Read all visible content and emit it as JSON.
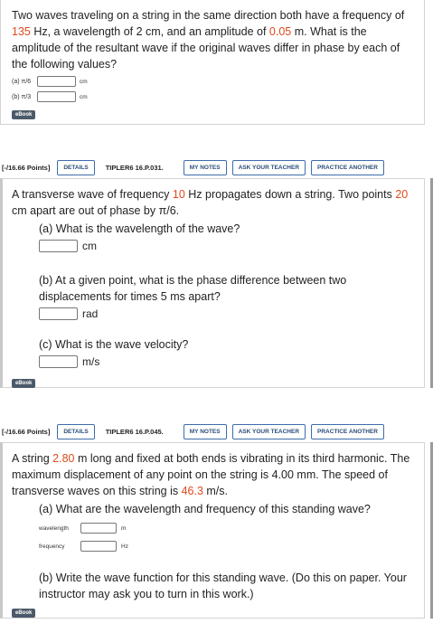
{
  "q1": {
    "prompt_before_freq": "Two waves traveling on a string in the same direction both have a frequency of ",
    "freq": "135",
    "prompt_mid": " Hz, a wavelength of 2 cm, and an amplitude of ",
    "amp": "0.05",
    "prompt_after": " m. What is the amplitude of the resultant wave if the original waves differ in phase by each of the following values?",
    "parts": [
      {
        "label": "(a) π/6",
        "unit": "cm"
      },
      {
        "label": "(b) π/3",
        "unit": "cm"
      }
    ],
    "ebook": "eBook"
  },
  "q2": {
    "points": "[-/16.66 Points]",
    "details": "DETAILS",
    "code": "TIPLER6 16.P.031.",
    "my_notes": "MY NOTES",
    "ask": "ASK YOUR TEACHER",
    "practice": "PRACTICE ANOTHER",
    "prompt_a": "A transverse wave of frequency ",
    "freq": "10",
    "prompt_b": " Hz propagates down a string. Two points ",
    "dist": "20",
    "prompt_c": " cm apart are out of phase by ",
    "phase": "π/6.",
    "part_a": "(a) What is the wavelength of the wave?",
    "part_a_unit": "cm",
    "part_b": "(b) At a given point, what is the phase difference between two displacements for times 5 ms apart?",
    "part_b_unit": "rad",
    "part_c": "(c) What is the wave velocity?",
    "part_c_unit": "m/s",
    "ebook": "eBook"
  },
  "q3": {
    "points": "[-/16.66 Points]",
    "details": "DETAILS",
    "code": "TIPLER6 16.P.045.",
    "my_notes": "MY NOTES",
    "ask": "ASK YOUR TEACHER",
    "practice": "PRACTICE ANOTHER",
    "prompt_a": "A string ",
    "length": "2.80",
    "prompt_b": " m long and fixed at both ends is vibrating in its third harmonic. The maximum displacement of any point on the string is 4.00 mm. The speed of transverse waves on this string is ",
    "speed": "46.3",
    "prompt_c": " m/s.",
    "part_a": "(a) What are the wavelength and frequency of this standing wave?",
    "wavelength_label": "wavelength",
    "wavelength_unit": "m",
    "frequency_label": "frequency",
    "frequency_unit": "Hz",
    "part_b": "(b) Write the wave function for this standing wave. (Do this on paper. Your instructor may ask you to turn in this work.)",
    "ebook": "eBook"
  },
  "colors": {
    "highlight": "#e0491b",
    "button_border": "#3d6dab",
    "ebook_bg": "#4b5a6a"
  }
}
